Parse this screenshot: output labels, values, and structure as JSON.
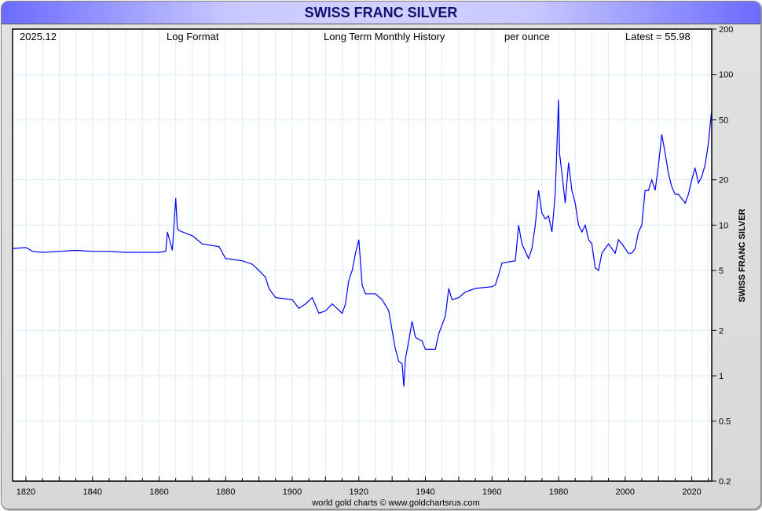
{
  "title": "SWISS FRANC SILVER",
  "header": {
    "date": "2025.12",
    "format": "Log Format",
    "history": "Long Term Monthly History",
    "unit": "per ounce",
    "latest": "Latest = 55.98"
  },
  "credit": "world gold charts © www.goldchartsrus.com",
  "colors": {
    "line": "#0000ff",
    "grid": "#dcecf8"
  },
  "chart_data": {
    "type": "line",
    "title": "SWISS FRANC SILVER",
    "ylabel": "SWISS FRANC SILVER",
    "yscale": "log",
    "ylim": [
      0.2,
      200
    ],
    "xlim": [
      1816,
      2026
    ],
    "yticks": [
      200,
      100,
      50,
      20,
      10,
      5,
      2,
      1,
      0.5,
      0.2
    ],
    "ytick_labels": [
      "200",
      "100",
      "50",
      "20",
      "10",
      "5",
      "2",
      "1",
      "0.5",
      "0.2"
    ],
    "xticks": [
      1820,
      1840,
      1860,
      1880,
      1900,
      1920,
      1940,
      1960,
      1980,
      2000,
      2020
    ],
    "xtick_labels": [
      "1820",
      "1840",
      "1860",
      "1880",
      "1900",
      "1920",
      "1940",
      "1960",
      "1980",
      "2000",
      "2020"
    ],
    "series": [
      {
        "name": "Swiss Franc Silver",
        "x": [
          1816,
          1820,
          1822,
          1825,
          1830,
          1835,
          1840,
          1845,
          1850,
          1855,
          1860,
          1862,
          1862.5,
          1864,
          1865,
          1865.5,
          1866,
          1870,
          1873,
          1878,
          1880,
          1885,
          1888,
          1890,
          1892,
          1893,
          1895,
          1900,
          1902,
          1904,
          1906,
          1908,
          1910,
          1912,
          1915,
          1916,
          1917,
          1918,
          1919,
          1920,
          1921,
          1922,
          1925,
          1927,
          1929,
          1930,
          1931,
          1932,
          1933,
          1933.5,
          1934,
          1935,
          1936,
          1937,
          1939,
          1940,
          1943,
          1944,
          1946,
          1947,
          1948,
          1950,
          1952,
          1955,
          1960,
          1961,
          1962,
          1963,
          1967,
          1968,
          1969,
          1971,
          1972,
          1973,
          1974,
          1975,
          1976,
          1977,
          1978,
          1979,
          1980,
          1980.3,
          1981,
          1982,
          1983,
          1984,
          1985,
          1986,
          1987,
          1988,
          1989,
          1990,
          1991,
          1992,
          1993,
          1994,
          1995,
          1996,
          1997,
          1998,
          1999,
          2000,
          2001,
          2002,
          2003,
          2004,
          2005,
          2006,
          2007,
          2008,
          2009,
          2010,
          2011,
          2012,
          2013,
          2014,
          2015,
          2016,
          2017,
          2018,
          2019,
          2020,
          2021,
          2022,
          2023,
          2024,
          2025,
          2025.9
        ],
        "values": [
          7.0,
          7.1,
          6.7,
          6.6,
          6.7,
          6.8,
          6.7,
          6.7,
          6.6,
          6.6,
          6.6,
          6.7,
          9.0,
          6.8,
          15.1,
          9.5,
          9.2,
          8.5,
          7.5,
          7.2,
          6.0,
          5.8,
          5.5,
          5.0,
          4.5,
          3.8,
          3.3,
          3.2,
          2.8,
          3.0,
          3.3,
          2.6,
          2.7,
          3.0,
          2.6,
          3.0,
          4.3,
          5.0,
          6.5,
          8.0,
          4.0,
          3.5,
          3.5,
          3.2,
          2.7,
          2.0,
          1.5,
          1.25,
          1.2,
          0.85,
          1.3,
          1.7,
          2.3,
          1.8,
          1.7,
          1.5,
          1.5,
          1.9,
          2.5,
          3.8,
          3.2,
          3.3,
          3.6,
          3.8,
          3.9,
          4.0,
          4.7,
          5.6,
          5.8,
          10,
          7.5,
          6,
          7,
          10,
          17,
          12,
          11,
          11.5,
          9,
          16,
          68,
          30,
          22,
          14,
          26,
          17,
          14,
          10,
          9,
          10,
          8,
          7.5,
          5.2,
          5,
          6.5,
          7,
          7.5,
          7,
          6.5,
          8,
          7.5,
          7,
          6.5,
          6.5,
          7,
          9,
          10,
          17,
          17,
          20,
          17,
          25,
          40,
          30,
          22,
          18,
          16,
          16,
          15,
          14,
          16,
          20,
          24,
          19,
          21,
          25,
          35,
          55.98
        ]
      }
    ]
  }
}
